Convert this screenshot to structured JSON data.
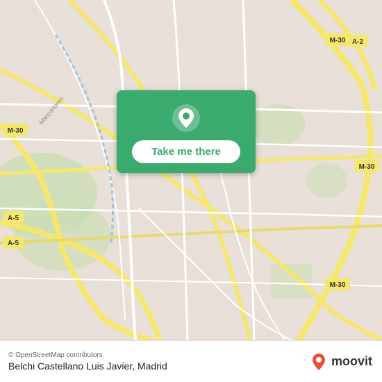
{
  "map": {
    "background_color": "#e8e0d8",
    "center": "Madrid, Spain"
  },
  "card": {
    "background_color": "#3aaa6e",
    "button_label": "Take me there",
    "pin_icon": "location-pin"
  },
  "bottom_bar": {
    "attribution": "© OpenStreetMap contributors",
    "location_name": "Belchi Castellano Luis Javier, Madrid",
    "logo_text": "moovit"
  }
}
